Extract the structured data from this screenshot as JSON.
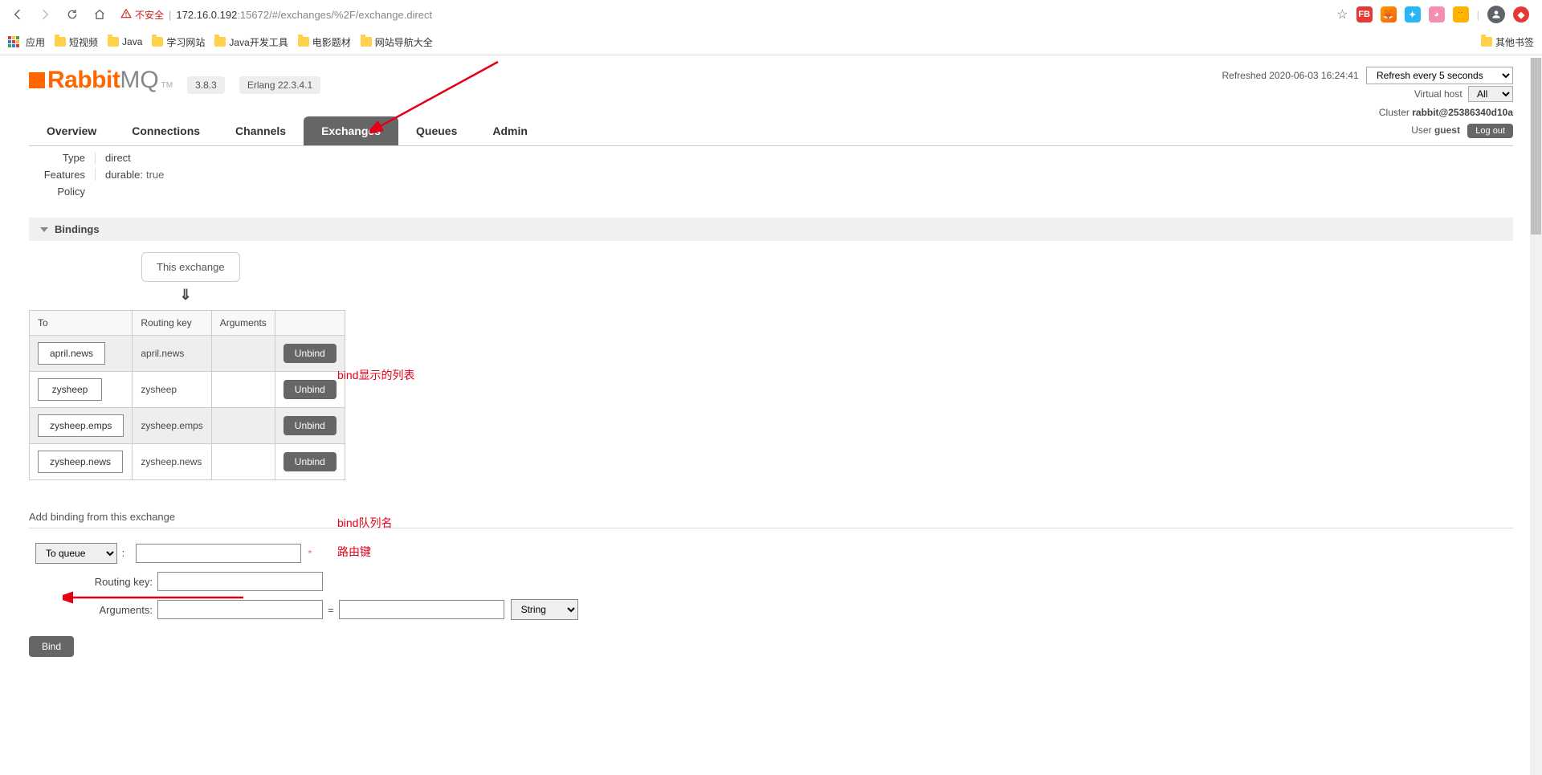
{
  "browser": {
    "insecure_label": "不安全",
    "url_host": "172.16.0.192",
    "url_port": ":15672",
    "url_path": "/#/exchanges/%2F/exchange.direct",
    "apps_label": "应用",
    "bookmarks": [
      "短视频",
      "Java",
      "学习网站",
      "Java开发工具",
      "电影题材",
      "网站导航大全"
    ],
    "other_bookmarks": "其他书签"
  },
  "header": {
    "brand_rabbit": "Rabbit",
    "brand_mq": "MQ",
    "tm": "TM",
    "version": "3.8.3",
    "erlang": "Erlang 22.3.4.1",
    "refreshed_label": "Refreshed",
    "refreshed_ts": "2020-06-03 16:24:41",
    "refresh_select": "Refresh every 5 seconds",
    "vhost_label": "Virtual host",
    "vhost_value": "All",
    "cluster_label": "Cluster",
    "cluster_name": "rabbit@25386340d10a",
    "user_label": "User",
    "user_name": "guest",
    "logout": "Log out"
  },
  "tabs": {
    "items": [
      "Overview",
      "Connections",
      "Channels",
      "Exchanges",
      "Queues",
      "Admin"
    ],
    "active_index": 3
  },
  "details": {
    "type_label": "Type",
    "type_val": "direct",
    "features_label": "Features",
    "feat_key": "durable:",
    "feat_val": "true",
    "policy_label": "Policy"
  },
  "bindings": {
    "section_title": "Bindings",
    "this_exchange": "This exchange",
    "arrow": "⇓",
    "cols": {
      "to": "To",
      "rk": "Routing key",
      "args": "Arguments"
    },
    "rows": [
      {
        "to": "april.news",
        "rk": "april.news",
        "args": ""
      },
      {
        "to": "zysheep",
        "rk": "zysheep",
        "args": ""
      },
      {
        "to": "zysheep.emps",
        "rk": "zysheep.emps",
        "args": ""
      },
      {
        "to": "zysheep.news",
        "rk": "zysheep.news",
        "args": ""
      }
    ],
    "unbind": "Unbind"
  },
  "add": {
    "title": "Add binding from this exchange",
    "to_queue": "To queue",
    "routing_key_label": "Routing key:",
    "arguments_label": "Arguments:",
    "type_sel": "String",
    "bind_btn": "Bind"
  },
  "annotations": {
    "bind_list": "bind显示的列表",
    "bind_queue": "bind队列名",
    "routing_key": "路由键"
  }
}
